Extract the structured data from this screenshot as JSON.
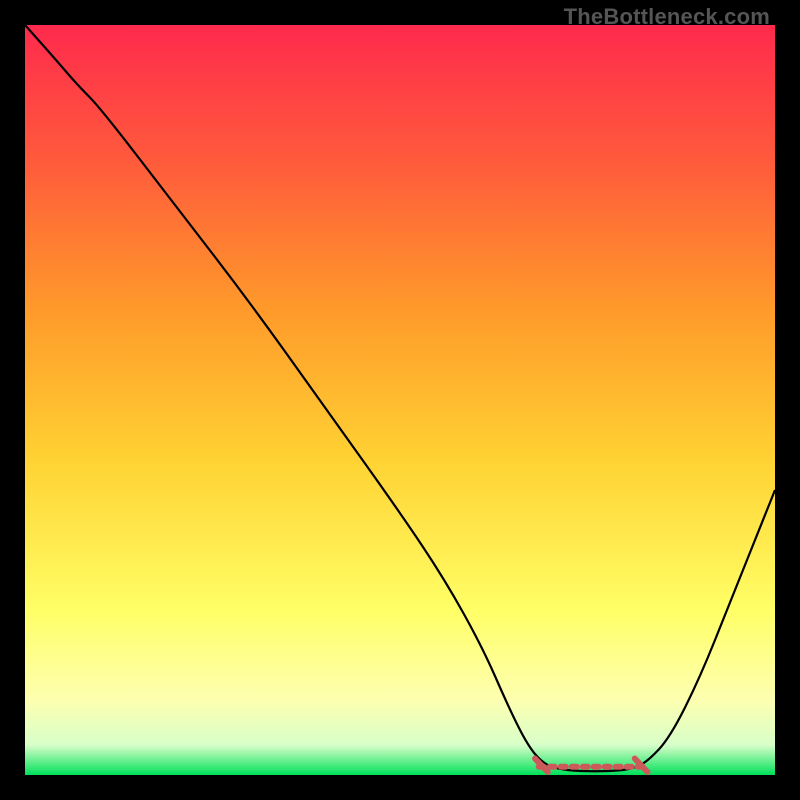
{
  "watermark": "TheBottleneck.com",
  "chart_data": {
    "type": "line",
    "title": "",
    "xlabel": "",
    "ylabel": "",
    "xlim": [
      0,
      100
    ],
    "ylim": [
      0,
      100
    ],
    "gradient_stops": [
      {
        "offset": 0,
        "color": "#ff2a4d"
      },
      {
        "offset": 18,
        "color": "#ff5a3c"
      },
      {
        "offset": 38,
        "color": "#ff9a2a"
      },
      {
        "offset": 58,
        "color": "#ffd233"
      },
      {
        "offset": 78,
        "color": "#ffff66"
      },
      {
        "offset": 90,
        "color": "#fdffb0"
      },
      {
        "offset": 96,
        "color": "#d8ffc9"
      },
      {
        "offset": 100,
        "color": "#00e05a"
      }
    ],
    "series": [
      {
        "name": "bottleneck-curve",
        "color": "#000000",
        "width": 2.2,
        "points": [
          {
            "x": 0,
            "y": 100
          },
          {
            "x": 4,
            "y": 95.5
          },
          {
            "x": 7,
            "y": 92
          },
          {
            "x": 10,
            "y": 89
          },
          {
            "x": 20,
            "y": 76
          },
          {
            "x": 30,
            "y": 63
          },
          {
            "x": 40,
            "y": 49
          },
          {
            "x": 50,
            "y": 35
          },
          {
            "x": 56,
            "y": 26
          },
          {
            "x": 61,
            "y": 17
          },
          {
            "x": 64.5,
            "y": 9
          },
          {
            "x": 67,
            "y": 4
          },
          {
            "x": 69,
            "y": 1.6
          },
          {
            "x": 71,
            "y": 0.8
          },
          {
            "x": 74,
            "y": 0.5
          },
          {
            "x": 78,
            "y": 0.5
          },
          {
            "x": 81,
            "y": 0.8
          },
          {
            "x": 83,
            "y": 1.8
          },
          {
            "x": 86,
            "y": 5
          },
          {
            "x": 90,
            "y": 13
          },
          {
            "x": 94,
            "y": 23
          },
          {
            "x": 98,
            "y": 33
          },
          {
            "x": 100,
            "y": 38
          }
        ]
      }
    ],
    "flat_zone": {
      "color": "#cc5a5a",
      "width": 6,
      "dash": [
        5,
        6
      ],
      "cap_len": 4,
      "x_start": 68.5,
      "x_end": 82.5,
      "y": 1.1,
      "y_cap_start": 2.2,
      "y_cap_end": 0.4
    }
  }
}
